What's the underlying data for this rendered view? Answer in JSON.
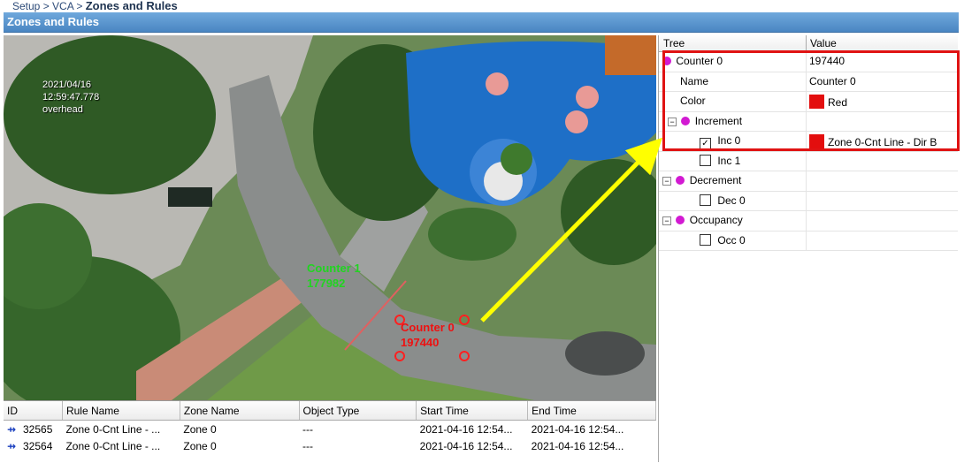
{
  "breadcrumb": {
    "path": "Setup > VCA >",
    "current": "Zones and Rules"
  },
  "panel_title": "Zones and Rules",
  "camera": {
    "osd_date": "2021/04/16",
    "osd_time": "12:59:47.778",
    "osd_label": "overhead",
    "counter1_name": "Counter 1",
    "counter1_value": "177982",
    "counter0_name": "Counter 0",
    "counter0_value": "197440"
  },
  "events": {
    "columns": [
      "ID",
      "Rule Name",
      "Zone Name",
      "Object Type",
      "Start Time",
      "End Time"
    ],
    "rows": [
      [
        "32565",
        "Zone 0-Cnt Line - ...",
        "Zone 0",
        "---",
        "2021-04-16 12:54...",
        "2021-04-16 12:54..."
      ],
      [
        "32564",
        "Zone 0-Cnt Line - ...",
        "Zone 0",
        "---",
        "2021-04-16 12:54...",
        "2021-04-16 12:54..."
      ]
    ]
  },
  "tree": {
    "col_tree": "Tree",
    "col_value": "Value",
    "counter_name": "Counter 0",
    "counter_value": "197440",
    "name_label": "Name",
    "name_value": "Counter 0",
    "color_label": "Color",
    "color_value": "Red",
    "color_hex": "#e30e0e",
    "increment_label": "Increment",
    "inc0_label": "Inc 0",
    "inc0_value": "Zone 0-Cnt Line - Dir B",
    "inc1_label": "Inc 1",
    "decrement_label": "Decrement",
    "dec0_label": "Dec 0",
    "occupancy_label": "Occupancy",
    "occ0_label": "Occ 0"
  }
}
